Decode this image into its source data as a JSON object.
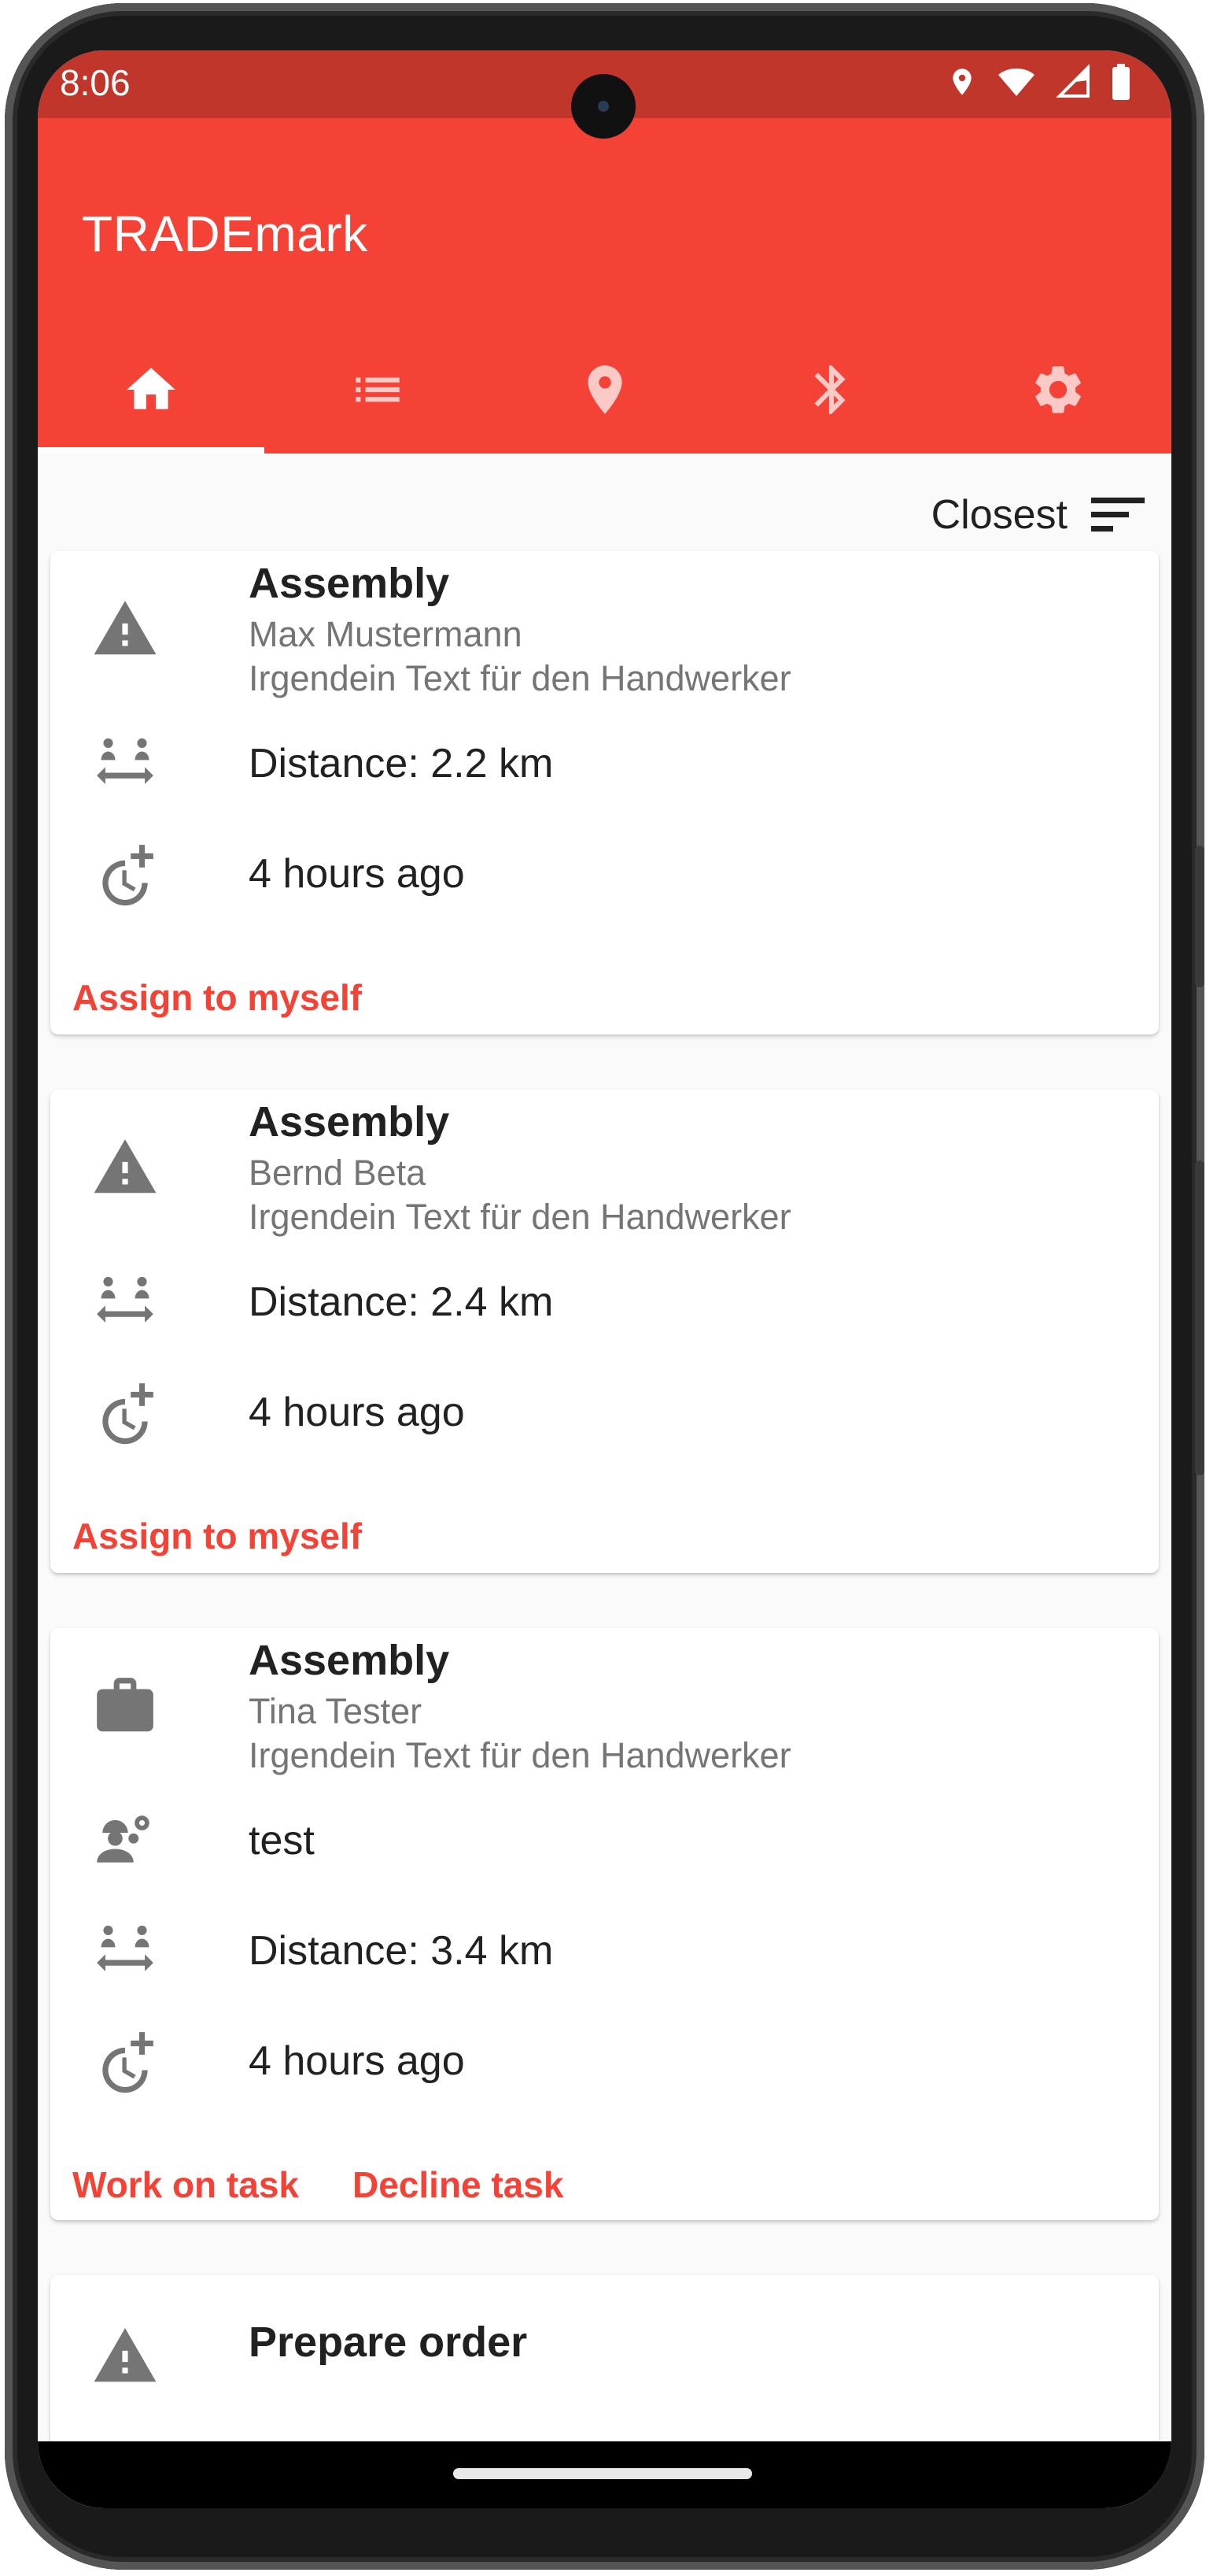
{
  "status_bar": {
    "time": "8:06",
    "icons": [
      "location-icon",
      "wifi-icon",
      "signal-icon",
      "battery-icon"
    ]
  },
  "app": {
    "title": "TRADEmark",
    "accent_color": "#f44336",
    "status_bar_color": "#c1362b"
  },
  "tabs": [
    {
      "icon": "home-icon",
      "active": true
    },
    {
      "icon": "list-icon",
      "active": false
    },
    {
      "icon": "map-pin-icon",
      "active": false
    },
    {
      "icon": "bluetooth-icon",
      "active": false
    },
    {
      "icon": "gear-icon",
      "active": false
    }
  ],
  "sort": {
    "label": "Closest",
    "icon": "sort-icon"
  },
  "tasks": [
    {
      "status_icon": "warning-icon",
      "title": "Assembly",
      "customer": "Max Mustermann",
      "description": "Irgendein Text für den Handwerker",
      "distance": "Distance: 2.2 km",
      "time": "4 hours ago",
      "actions": [
        "Assign to myself"
      ]
    },
    {
      "status_icon": "warning-icon",
      "title": "Assembly",
      "customer": "Bernd Beta",
      "description": "Irgendein Text für den Handwerker",
      "distance": "Distance: 2.4 km",
      "time": "4 hours ago",
      "actions": [
        "Assign to myself"
      ]
    },
    {
      "status_icon": "briefcase-icon",
      "title": "Assembly",
      "customer": "Tina Tester",
      "description": "Irgendein Text für den Handwerker",
      "worker": "test",
      "distance": "Distance: 3.4 km",
      "time": "4 hours ago",
      "actions": [
        "Work on task",
        "Decline task"
      ]
    },
    {
      "status_icon": "warning-icon",
      "title": "Prepare order"
    }
  ]
}
